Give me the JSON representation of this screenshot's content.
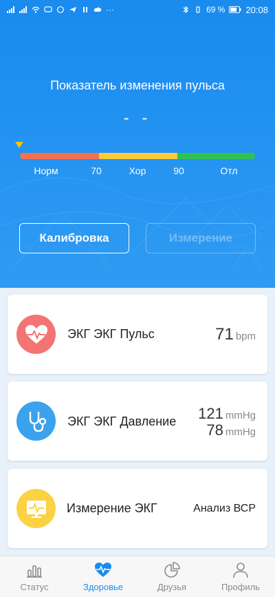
{
  "status_bar": {
    "battery": "69 %",
    "time": "20:08"
  },
  "hero": {
    "title": "Показатель изменения пульса",
    "value": "- -",
    "scale_segments": [
      {
        "color": "#f7704d",
        "fraction": 0.335
      },
      {
        "color": "#ffcc35",
        "fraction": 0.335
      },
      {
        "color": "#2fc250",
        "fraction": 0.33
      }
    ],
    "scale_labels": [
      "Норм",
      "70",
      "Хор",
      "90",
      "Отл"
    ],
    "calibrate_label": "Калибровка",
    "measure_label": "Измерение"
  },
  "cards": {
    "pulse": {
      "title": "ЭКГ ЭКГ Пульс",
      "value": "71",
      "unit": "bpm",
      "icon_color": "#f47474"
    },
    "pressure": {
      "title": "ЭКГ ЭКГ Давление",
      "systolic": "121",
      "diastolic": "78",
      "unit": "mmHg",
      "icon_color": "#3ba2ee"
    },
    "ecg": {
      "title": "Измерение ЭКГ",
      "right_label": "Анализ ВСР",
      "icon_color": "#fbd244"
    }
  },
  "nav": {
    "items": [
      {
        "label": "Статус"
      },
      {
        "label": "Здоровье"
      },
      {
        "label": "Друзья"
      },
      {
        "label": "Профиль"
      }
    ]
  },
  "colors": {
    "primary": "#1a8cf0",
    "nav_inactive": "#8a8a8a"
  }
}
